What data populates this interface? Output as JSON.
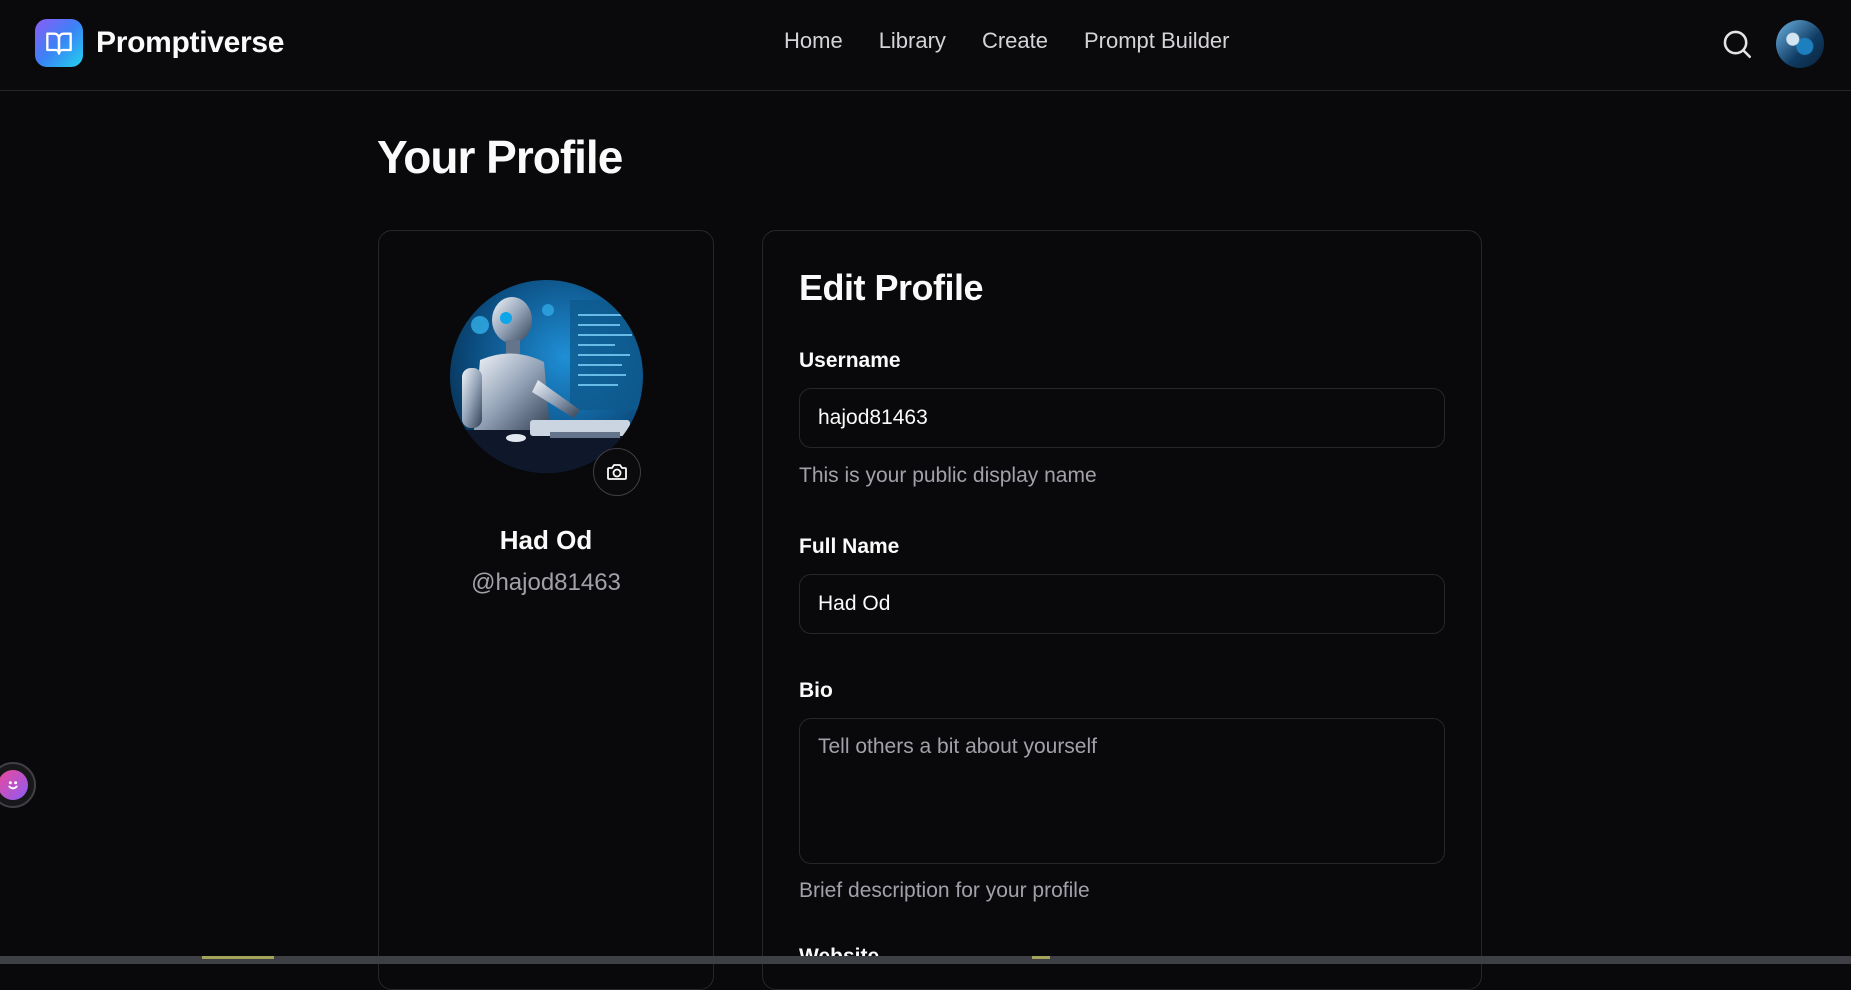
{
  "brand": {
    "name": "Promptiverse",
    "accent": "#8b5cf6"
  },
  "nav": {
    "items": [
      "Home",
      "Library",
      "Create",
      "Prompt Builder"
    ]
  },
  "header": {
    "search_icon": "search-icon",
    "avatar": "user-avatar"
  },
  "page": {
    "title": "Your Profile"
  },
  "profile": {
    "name": "Had Od",
    "handle": "@hajod81463",
    "camera_icon": "camera-icon"
  },
  "edit": {
    "title": "Edit Profile",
    "username_label": "Username",
    "username_value": "hajod81463",
    "username_help": "This is your public display name",
    "fullname_label": "Full Name",
    "fullname_value": "Had Od",
    "bio_label": "Bio",
    "bio_placeholder": "Tell others a bit about yourself",
    "bio_help": "Brief description for your profile",
    "website_label": "Website"
  },
  "colors": {
    "background": "#09090b",
    "border": "#27272a",
    "muted": "#a1a1aa"
  }
}
